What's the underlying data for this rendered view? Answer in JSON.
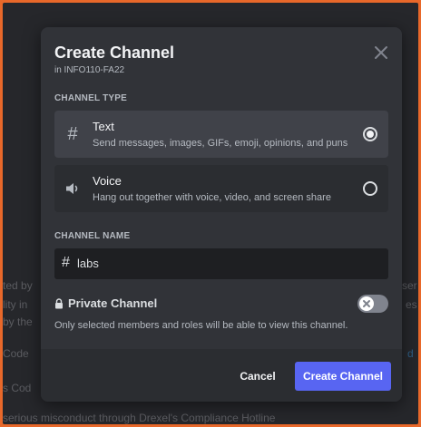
{
  "background": {
    "lines": [
      {
        "text": "ted by"
      },
      {
        "text": "lity in"
      },
      {
        "text": "by the"
      },
      {
        "text": "Code"
      },
      {
        "text": "s Cod"
      },
      {
        "text": "serious misconduct through Drexel's Compliance Hotline"
      }
    ],
    "right_fragments": [
      "ser",
      "es",
      "d"
    ]
  },
  "modal": {
    "title": "Create Channel",
    "subtitle": "in INFO110-FA22",
    "channel_type": {
      "label": "CHANNEL TYPE",
      "options": [
        {
          "icon": "#",
          "name": "Text",
          "description": "Send messages, images, GIFs, emoji, opinions, and puns",
          "selected": true
        },
        {
          "icon": "voice-speaker-icon",
          "name": "Voice",
          "description": "Hang out together with voice, video, and screen share",
          "selected": false
        }
      ]
    },
    "channel_name": {
      "label": "CHANNEL NAME",
      "prefix": "#",
      "value": "labs"
    },
    "private_channel": {
      "label": "Private Channel",
      "description": "Only selected members and roles will be able to view this channel.",
      "enabled": false
    },
    "footer": {
      "cancel_label": "Cancel",
      "create_label": "Create Channel"
    }
  },
  "colors": {
    "frame": "#e8682a",
    "modal": "#313338",
    "accent": "#5865f2",
    "input_bg": "#1e1f22"
  }
}
